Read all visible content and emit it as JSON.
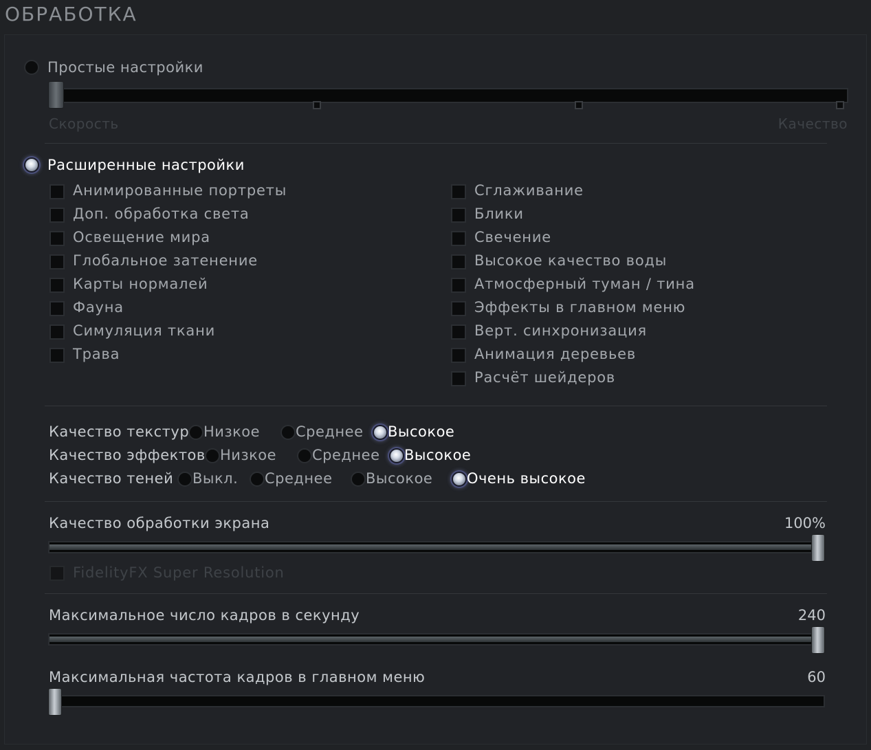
{
  "title": "ОБРАБОТКА",
  "simple": {
    "label": "Простые настройки",
    "left_label": "Скорость",
    "right_label": "Качество",
    "level": 0
  },
  "advanced": {
    "label": "Расширенные настройки",
    "left_checkboxes": [
      "Анимированные портреты",
      "Доп. обработка света",
      "Освещение мира",
      "Глобальное затенение",
      "Карты нормалей",
      "Фауна",
      "Симуляция ткани",
      "Трава"
    ],
    "right_checkboxes": [
      "Сглаживание",
      "Блики",
      "Свечение",
      "Высокое качество воды",
      "Атмосферный туман / тина",
      "Эффекты в главном меню",
      "Верт. синхронизация",
      "Анимация деревьев",
      "Расчёт шейдеров"
    ]
  },
  "quality": {
    "textures": {
      "label": "Качество текстур",
      "options": [
        "Низкое",
        "Среднее",
        "Высокое"
      ],
      "selected": "Высокое"
    },
    "effects": {
      "label": "Качество эффектов",
      "options": [
        "Низкое",
        "Среднее",
        "Высокое"
      ],
      "selected": "Высокое"
    },
    "shadows": {
      "label": "Качество теней",
      "options": [
        "Выкл.",
        "Среднее",
        "Высокое",
        "Очень высокое"
      ],
      "selected": "Очень высокое"
    }
  },
  "screen_quality": {
    "label": "Качество обработки экрана",
    "value": "100%",
    "fraction": 1.0
  },
  "fsr": {
    "label": "FidelityFX Super Resolution",
    "enabled": false
  },
  "max_fps": {
    "label": "Максимальное число кадров в секунду",
    "value": "240",
    "fraction": 1.0
  },
  "menu_fps": {
    "label": "Максимальная частота кадров в главном меню",
    "value": "60",
    "fraction": 0.0
  },
  "colors": {
    "background": "#202225",
    "text": "#a4a8ad",
    "selected_text": "#ffffff",
    "disabled_text": "#3e4247"
  }
}
